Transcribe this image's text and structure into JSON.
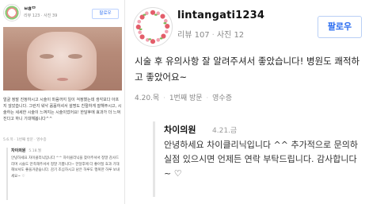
{
  "left_card": {
    "username": "ㅂ8ᄆ",
    "meta": "리뷰 123 · 사진 39",
    "follow_label": "팔로우",
    "review_text": "얼굴 정말 진정하시고 시술이 마음까지 일이 걱정했는데 생각보다 아프지 않았습니다. 그런지 워낙 꼼꼼하셔서 설명도 친절하게 잘해주시고, 시술하는 세세한 시술이 느껴지는 시술이었어요! 한달후에 효과가 더 느껴진다고 하니 기대해봅니다^^",
    "visit": "5.6.목 · 1번째 방문 · 영수증",
    "reply_name": "차이의원",
    "reply_date": "5.18.월",
    "reply_text": "안녕하세요 차이클리닉입니다 ^^ 차이클리닉을 찾아주셔서 정말 감사드리며 시술도 만족해주셔서 정말 기쁩니다~ 한달후에 더 좋아질 효과 기대해보셔도 좋을거같습니다. 감기 조심하시고 남은 하루도 행복한 하루 보내세요~ ♡"
  },
  "main_card": {
    "username": "lintangati1234",
    "reviews": "리뷰 107",
    "photos": "사진 12",
    "follow_label": "팔로우",
    "review_text": "시술 후 유의사항 잘 알려주셔서 좋았습니다! 병원도 쾌적하고 좋았어요~",
    "visit_date": "4.20.목",
    "visit_count": "1번째 방문",
    "visit_receipt": "영수증",
    "reply": {
      "name": "차이의원",
      "date": "4.21.금",
      "text": "안녕하세요 차이클리닉입니다 ^^ 추가적으로 문의하실점 있으시면 언제든 연락 부탁드립니다. 감사합니다 ~ ♡"
    }
  },
  "colors": {
    "accent": "#2a6cf0",
    "follow_border": "#b9cff5",
    "muted": "#888888"
  }
}
